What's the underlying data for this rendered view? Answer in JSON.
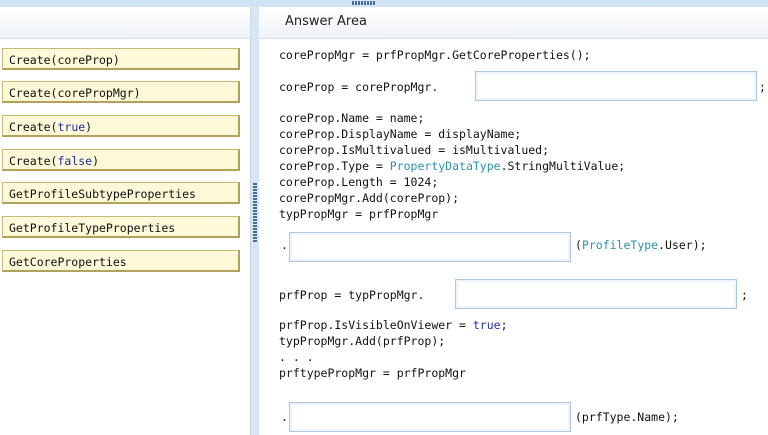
{
  "answer_area": {
    "title": "Answer Area"
  },
  "options": [
    {
      "pre": "Create(",
      "kw": "",
      "arg": "coreProp",
      "post": ")"
    },
    {
      "pre": "Create(",
      "kw": "",
      "arg": "corePropMgr",
      "post": ")"
    },
    {
      "pre": "Create(",
      "kw": "true",
      "arg": "",
      "post": ")"
    },
    {
      "pre": "Create(",
      "kw": "false",
      "arg": "",
      "post": ")"
    },
    {
      "pre": "GetProfileSubtypeProperties",
      "kw": "",
      "arg": "",
      "post": ""
    },
    {
      "pre": "GetProfileTypeProperties",
      "kw": "",
      "arg": "",
      "post": ""
    },
    {
      "pre": "GetCoreProperties",
      "kw": "",
      "arg": "",
      "post": ""
    }
  ],
  "code": {
    "line1": "corePropMgr = prfPropMgr.GetCoreProperties();",
    "line2_prefix": "coreProp = corePropMgr.",
    "line2_suffix": ";",
    "block1": [
      "coreProp.Name = name;",
      "coreProp.DisplayName = displayName;",
      "coreProp.IsMultivalued = isMultivalued;"
    ],
    "type_line": {
      "pre": "coreProp.Type = ",
      "type": "PropertyDataType",
      "post": ".StringMultiValue;"
    },
    "block2": [
      "coreProp.Length = 1024;",
      "corePropMgr.Add(coreProp);",
      "typPropMgr = prfPropMgr"
    ],
    "dot1": ".",
    "user_line": {
      "pre": "(",
      "type": "ProfileType",
      "post": ".User);"
    },
    "prf_prefix": "prfProp = typPropMgr.",
    "prf_suffix": ";",
    "visible_line": {
      "pre": "prfProp.IsVisibleOnViewer = ",
      "kw": "true",
      "post": ";"
    },
    "block3": [
      "typPropMgr.Add(prfProp);",
      ". . .",
      "prftypePropMgr = prfPropMgr"
    ],
    "dot2": ".",
    "name_suffix": "(prfType.Name);"
  }
}
